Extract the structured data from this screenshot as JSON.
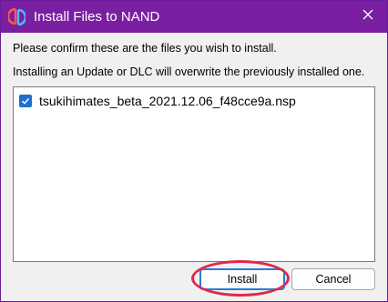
{
  "window": {
    "title": "Install Files to NAND",
    "titlebar_color": "#7a1fa2",
    "close_icon": "close-icon"
  },
  "dialog": {
    "message_line1": "Please confirm these are the files you wish to install.",
    "message_line2": "Installing an Update or DLC will overwrite the previously installed one."
  },
  "file_list": {
    "items": [
      {
        "checked": true,
        "name": "tsukihimates_beta_2021.12.06_f48cce9a.nsp"
      }
    ]
  },
  "buttons": {
    "install_label": "Install",
    "cancel_label": "Cancel"
  },
  "accent_color": "#1f6fd1",
  "highlight_color": "#e0284a"
}
